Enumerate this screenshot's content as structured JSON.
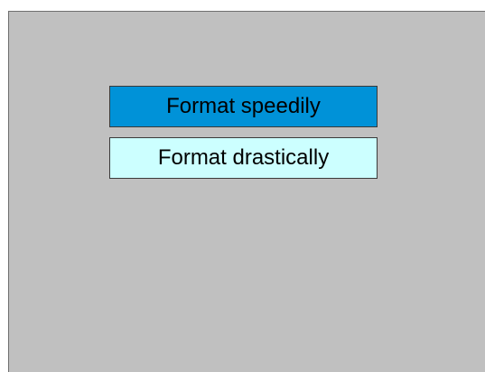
{
  "menu": {
    "items": [
      {
        "label": "Format speedily",
        "selected": true
      },
      {
        "label": "Format drastically",
        "selected": false
      }
    ]
  },
  "colors": {
    "screen_background": "#c0c0c0",
    "selected_item": "#0092d8",
    "unselected_item": "#ccffff",
    "border": "#3a3a3a"
  }
}
